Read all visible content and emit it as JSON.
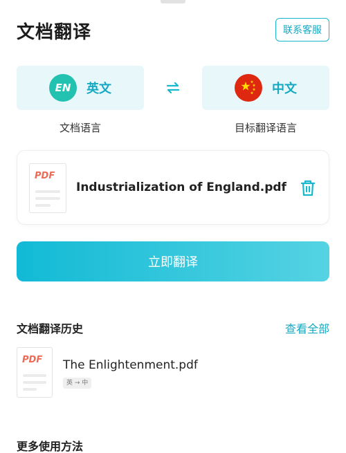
{
  "header": {
    "title": "文档翻译",
    "contact_label": "联系客服"
  },
  "languages": {
    "source": {
      "badge": "EN",
      "name": "英文",
      "caption": "文档语言"
    },
    "target": {
      "name": "中文",
      "caption": "目标翻译语言"
    },
    "swap_icon": "swap-arrows-icon"
  },
  "file": {
    "type_label": "PDF",
    "name": "Industrialization of England.pdf",
    "delete_icon": "trash-icon"
  },
  "translate_button": "立即翻译",
  "history": {
    "title": "文档翻译历史",
    "view_all": "查看全部",
    "items": [
      {
        "type_label": "PDF",
        "name": "The Enlightenment.pdf",
        "direction": "英 → 中"
      }
    ]
  },
  "more": {
    "title": "更多使用方法"
  },
  "colors": {
    "accent": "#16a9c2",
    "card_bg": "#e8f8fa",
    "pdf_red": "#ec6a56",
    "flag_red": "#de2910",
    "flag_yellow": "#ffde00"
  }
}
